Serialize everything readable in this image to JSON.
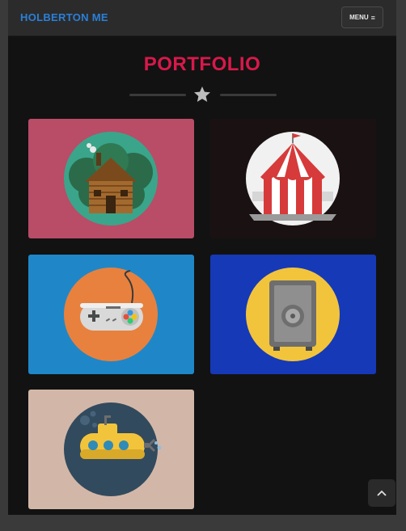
{
  "navbar": {
    "brand": "HOLBERTON ME",
    "menu_label": "MENU",
    "menu_icon": "hamburger-icon"
  },
  "portfolio": {
    "title": "PORTFOLIO",
    "divider_icon": "star-icon",
    "items": [
      {
        "icon": "log-cabin-icon",
        "background": "#b94c67",
        "circle": "#3aa58a"
      },
      {
        "icon": "circus-tent-icon",
        "background": "#1a1212",
        "circle": "#f1f1f1"
      },
      {
        "icon": "game-controller-icon",
        "background": "#1f87c8",
        "circle": "#e8813e"
      },
      {
        "icon": "safe-icon",
        "background": "#1639b8",
        "circle": "#f2c43c"
      },
      {
        "icon": "submarine-icon",
        "background": "#d2b7a8",
        "circle": "#324a5d"
      }
    ]
  },
  "scroll_top_icon": "chevron-up-icon",
  "colors": {
    "accent": "#d8194a",
    "brand": "#2b7fd8",
    "background": "#121212"
  }
}
